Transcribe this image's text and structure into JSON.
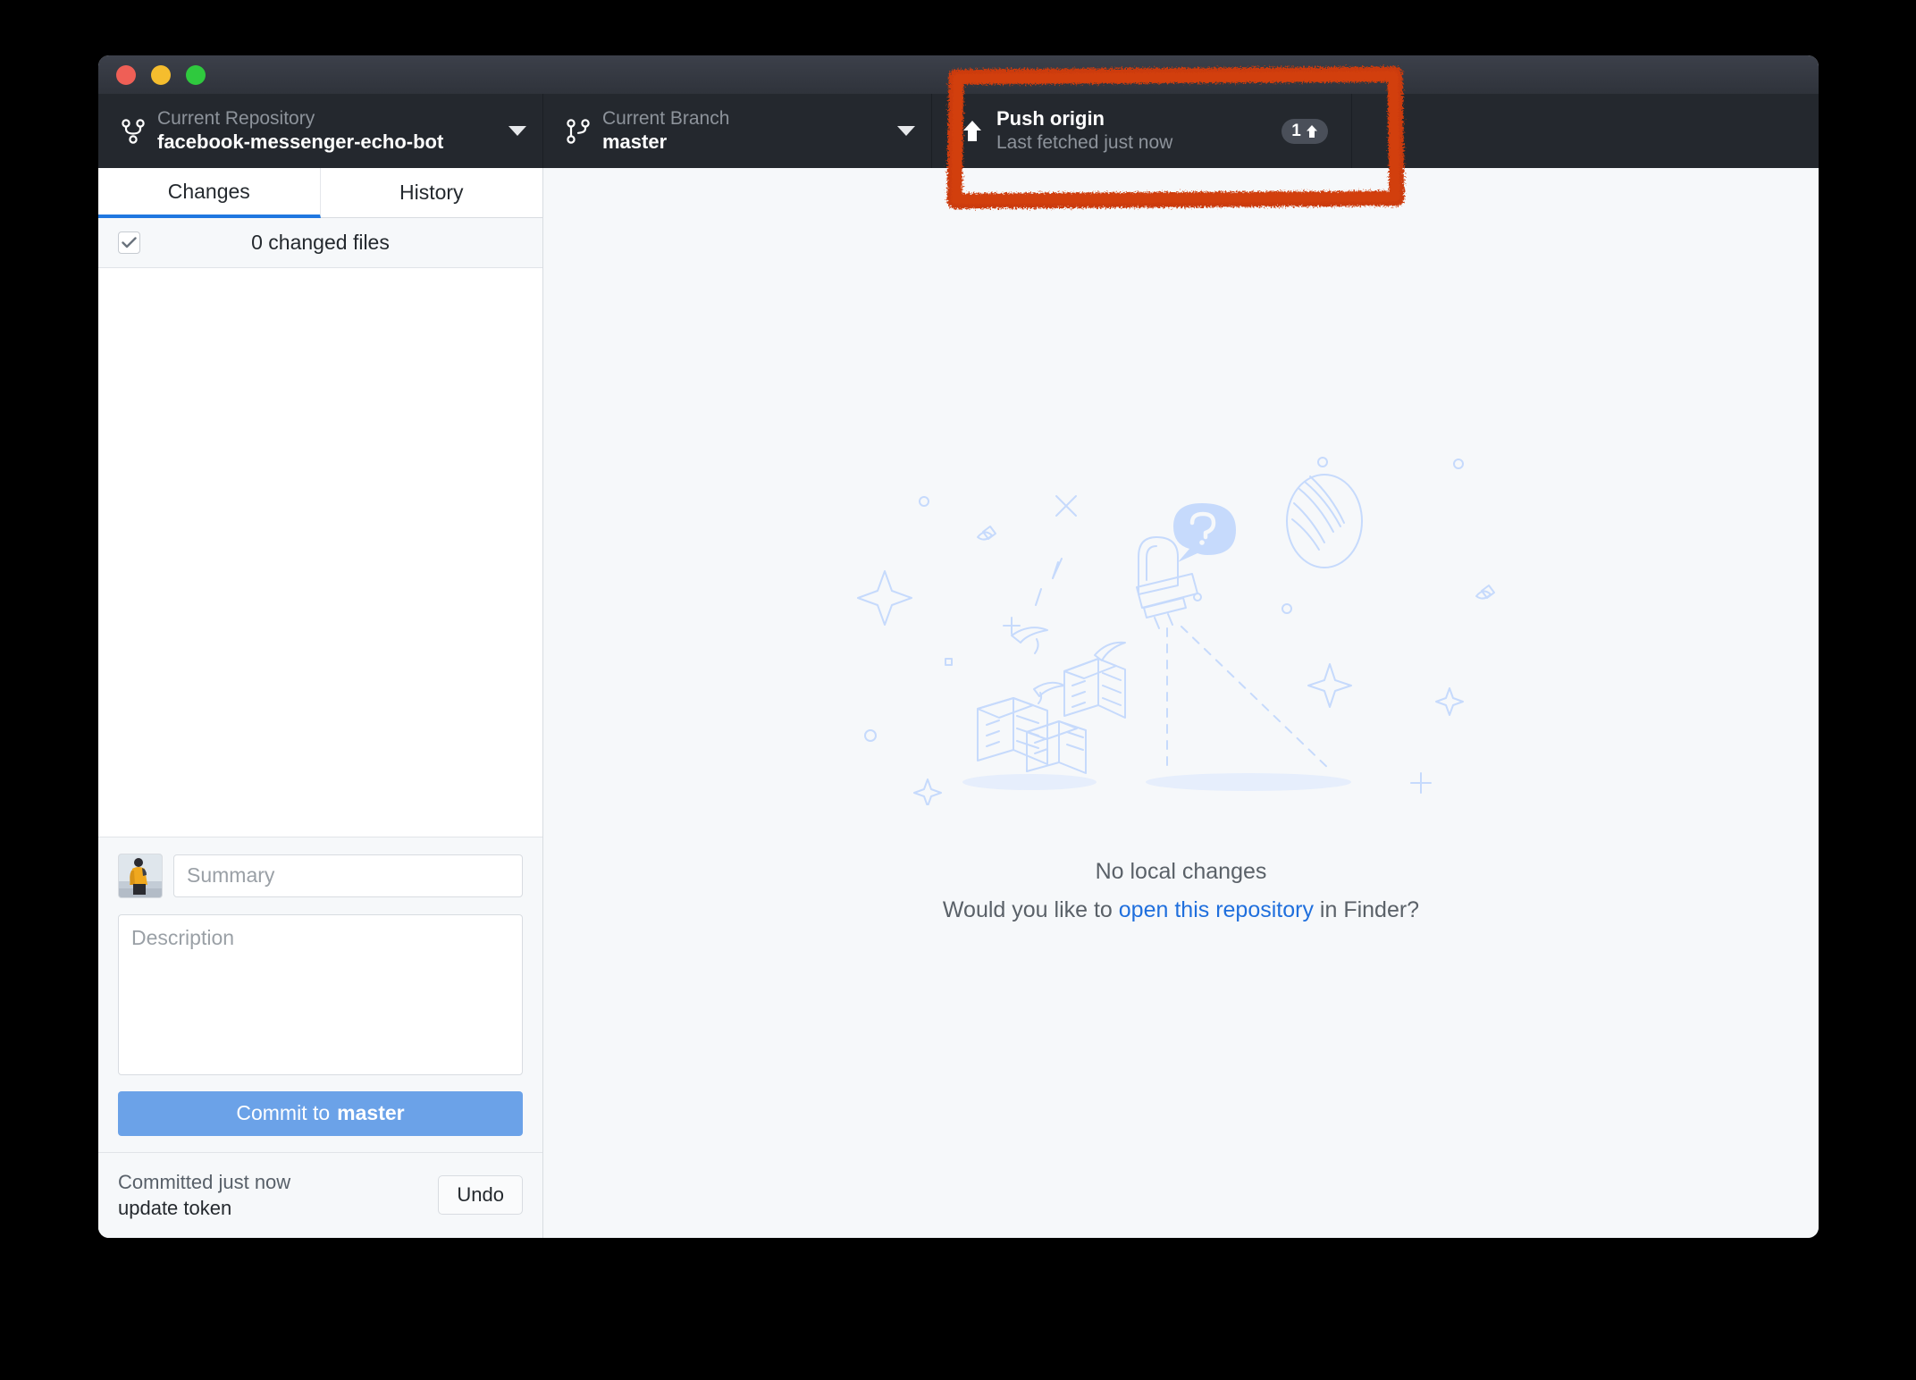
{
  "window": {
    "traffic_lights": [
      "close",
      "minimize",
      "maximize"
    ],
    "colors": {
      "titlebar_top": "#3c404a",
      "titlebar_bottom": "#2f333b",
      "toolbar": "#24282e",
      "accent_blue": "#1f77e0",
      "commit_button": "#6ba2e8",
      "link_blue": "#1f6fdd",
      "annotation_red": "#cc3a0a",
      "panel_bg": "#f6f8fa"
    }
  },
  "toolbar": {
    "repository": {
      "label": "Current Repository",
      "value": "facebook-messenger-echo-bot",
      "icon": "git-branch-icon",
      "caret": "chevron-down-icon"
    },
    "branch": {
      "label": "Current Branch",
      "value": "master",
      "icon": "git-branch-icon",
      "caret": "chevron-down-icon"
    },
    "push": {
      "title": "Push origin",
      "subtitle": "Last fetched just now",
      "icon": "arrow-up-icon",
      "badge_count": "1",
      "badge_icon": "arrow-up-icon"
    }
  },
  "sidebar": {
    "tabs": [
      {
        "label": "Changes",
        "active": true
      },
      {
        "label": "History",
        "active": false
      }
    ],
    "changed_files": {
      "label": "0 changed files",
      "checkbox_state": "checked"
    },
    "commit": {
      "summary_placeholder": "Summary",
      "summary_value": "",
      "description_placeholder": "Description",
      "description_value": "",
      "button_prefix": "Commit to ",
      "button_branch": "master"
    },
    "undo": {
      "title": "Committed just now",
      "subtitle": "update token",
      "button_label": "Undo"
    }
  },
  "main": {
    "empty_title": "No local changes",
    "empty_subtitle_before": "Would you like to ",
    "empty_subtitle_link": "open this repository",
    "empty_subtitle_after": " in Finder?",
    "illustration": "telescope-illustration"
  },
  "annotation": {
    "shape": "rectangle-highlight",
    "target": "push-origin-button",
    "color": "#cc3a0a"
  }
}
